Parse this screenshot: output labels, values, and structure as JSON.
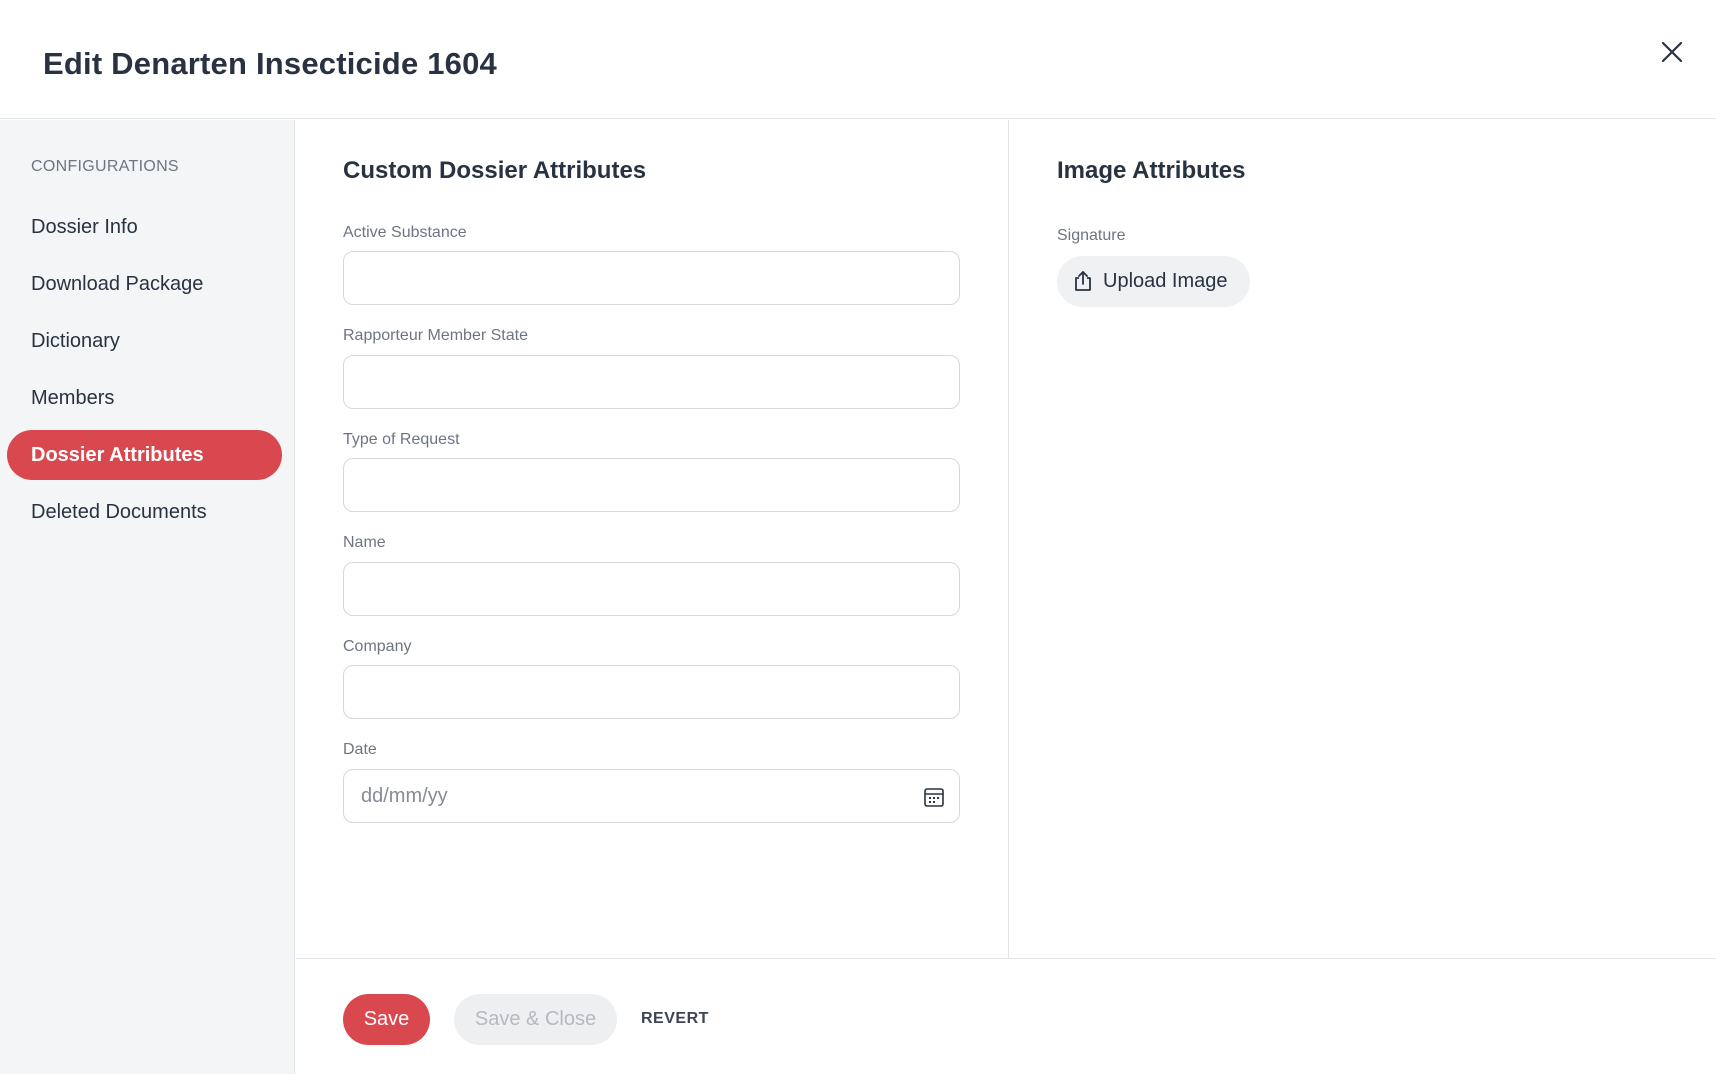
{
  "header": {
    "title": "Edit Denarten Insecticide 1604"
  },
  "sidebar": {
    "heading": "CONFIGURATIONS",
    "items": [
      {
        "label": "Dossier Info",
        "active": false
      },
      {
        "label": "Download Package",
        "active": false
      },
      {
        "label": "Dictionary",
        "active": false
      },
      {
        "label": "Members",
        "active": false
      },
      {
        "label": "Dossier Attributes",
        "active": true
      },
      {
        "label": "Deleted Documents",
        "active": false
      }
    ]
  },
  "custom_attributes": {
    "title": "Custom Dossier Attributes",
    "fields": [
      {
        "label": "Active Substance",
        "value": ""
      },
      {
        "label": "Rapporteur Member State",
        "value": ""
      },
      {
        "label": "Type of Request",
        "value": ""
      },
      {
        "label": "Name",
        "value": ""
      },
      {
        "label": "Company",
        "value": ""
      },
      {
        "label": "Date",
        "value": "",
        "placeholder": "dd/mm/yy"
      }
    ]
  },
  "image_attributes": {
    "title": "Image Attributes",
    "signature_label": "Signature",
    "upload_label": "Upload Image"
  },
  "footer": {
    "save_label": "Save",
    "save_close_label": "Save & Close",
    "revert_label": "REVERT"
  },
  "colors": {
    "accent": "#d9484f",
    "sidebar_bg": "#f4f5f7",
    "text": "#283241",
    "muted": "#6e7582"
  }
}
